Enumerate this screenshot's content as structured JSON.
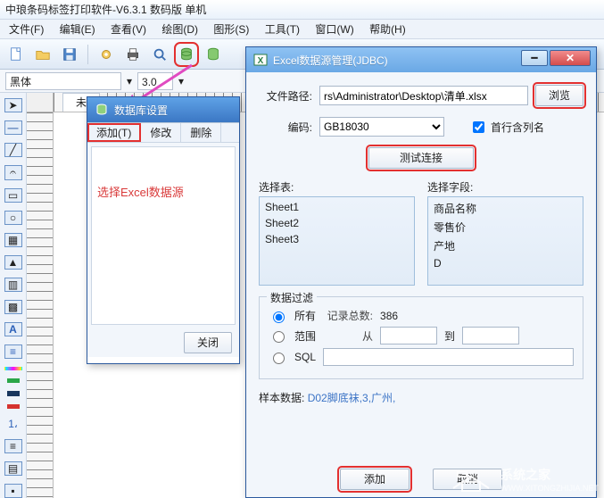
{
  "title": "中琅条码标签打印软件-V6.3.1 数码版 单机",
  "menus": [
    "文件(F)",
    "编辑(E)",
    "查看(V)",
    "绘图(D)",
    "图形(S)",
    "工具(T)",
    "窗口(W)",
    "帮助(H)"
  ],
  "subbar": {
    "font": "黑体",
    "size": "3.0"
  },
  "left_tools": [
    "cursor",
    "text",
    "line",
    "polyline",
    "rect",
    "ellipse",
    "grid",
    "dot",
    "barcode",
    "qr",
    "char-a",
    "lines",
    "colorbar",
    "green-sq",
    "navy-sq",
    "red-sq",
    "num",
    "tool1",
    "tool2",
    "tool3"
  ],
  "tabs": [
    "未"
  ],
  "ds_win": {
    "title": "数据库设置",
    "tabs": {
      "add": "添加(T)",
      "edit": "修改",
      "delete": "删除"
    },
    "note": "选择Excel数据源",
    "close_btn": "关闭"
  },
  "jdbc": {
    "title": "Excel数据源管理(JDBC)",
    "labels": {
      "path": "文件路径:",
      "encoding": "编码:",
      "first_row_header": "首行含列名",
      "browse": "浏览",
      "test": "测试连接",
      "select_table": "选择表:",
      "select_field": "选择字段:",
      "filter": "数据过滤",
      "all": "所有",
      "total_label": "记录总数:",
      "range": "范围",
      "from": "从",
      "to": "到",
      "sql": "SQL",
      "sample": "样本数据:",
      "add": "添加",
      "cancel": "取消"
    },
    "path": "rs\\Administrator\\Desktop\\清单.xlsx",
    "encoding": "GB18030",
    "first_row_header": true,
    "tables": [
      "Sheet1",
      "Sheet2",
      "Sheet3"
    ],
    "fields": [
      "商品名称",
      "零售价",
      "产地",
      "D"
    ],
    "filter": {
      "mode": "all",
      "total": "386",
      "from": "",
      "to": "",
      "sql": ""
    },
    "sample": "D02脚底袜,3,广州,"
  },
  "watermark": "系统之家",
  "watermark_url": "WWW.XITONGZHIJIA.NET"
}
